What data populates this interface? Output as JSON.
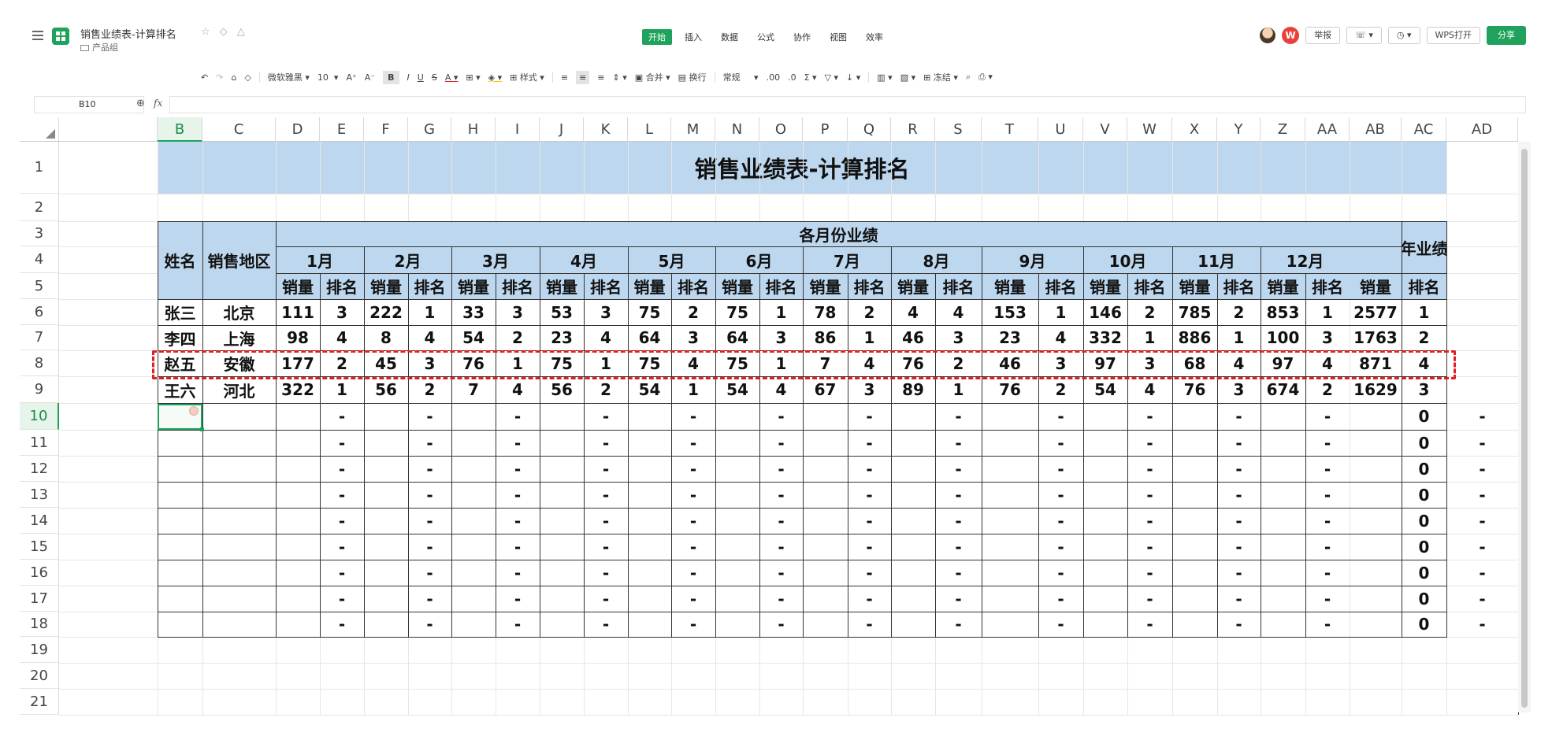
{
  "header": {
    "doc_title": "销售业绩表-计算排名",
    "doc_group": "产品组",
    "menu": [
      "开始",
      "插入",
      "数据",
      "公式",
      "协作",
      "视图",
      "效率"
    ],
    "active_menu": 0,
    "report_label": "举报",
    "wps_open_label": "WPS打开",
    "share_label": "分享",
    "accent_color": "#1fa35c"
  },
  "toolbar": {
    "font_name": "微软雅黑",
    "font_size": "10",
    "style_label": "样式",
    "merge_label": "合并",
    "wrap_label": "换行",
    "number_format": "常规",
    "freeze_label": "冻结"
  },
  "formula_bar": {
    "cell_ref": "B10",
    "fx_label": "fx",
    "content": ""
  },
  "columns": [
    "B",
    "C",
    "D",
    "E",
    "F",
    "G",
    "H",
    "I",
    "J",
    "K",
    "L",
    "M",
    "N",
    "O",
    "P",
    "Q",
    "R",
    "S",
    "T",
    "U",
    "V",
    "W",
    "X",
    "Y",
    "Z",
    "AA",
    "AB",
    "AC",
    "AD"
  ],
  "rows": [
    "1",
    "2",
    "3",
    "4",
    "5",
    "6",
    "7",
    "8",
    "9",
    "10",
    "11",
    "12",
    "13",
    "14",
    "15",
    "16",
    "17",
    "18",
    "19",
    "20",
    "21"
  ],
  "selected_cell": "B10",
  "table": {
    "title": "销售业绩表-计算排名",
    "col_name": "姓名",
    "col_region": "销售地区",
    "group_header": "各月份业绩",
    "months": [
      "1月",
      "2月",
      "3月",
      "4月",
      "5月",
      "6月",
      "7月",
      "8月",
      "9月",
      "10月",
      "11月",
      "12月"
    ],
    "year_header": "年业绩",
    "sub_sales": "销量",
    "sub_rank": "排名",
    "header_fill": "#bdd7ee",
    "highlight_color": "#e02020",
    "highlight_row": "8",
    "records": [
      {
        "name": "张三",
        "region": "北京",
        "values": [
          "111",
          "3",
          "222",
          "1",
          "33",
          "3",
          "53",
          "3",
          "75",
          "2",
          "75",
          "1",
          "78",
          "2",
          "4",
          "4",
          "153",
          "1",
          "146",
          "2",
          "785",
          "2",
          "853",
          "1",
          "2577",
          "1"
        ]
      },
      {
        "name": "李四",
        "region": "上海",
        "values": [
          "98",
          "4",
          "8",
          "4",
          "54",
          "2",
          "23",
          "4",
          "64",
          "3",
          "64",
          "3",
          "86",
          "1",
          "46",
          "3",
          "23",
          "4",
          "332",
          "1",
          "886",
          "1",
          "100",
          "3",
          "1763",
          "2"
        ]
      },
      {
        "name": "赵五",
        "region": "安徽",
        "values": [
          "177",
          "2",
          "45",
          "3",
          "76",
          "1",
          "75",
          "1",
          "75",
          "4",
          "75",
          "1",
          "7",
          "4",
          "76",
          "2",
          "46",
          "3",
          "97",
          "3",
          "68",
          "4",
          "97",
          "4",
          "871",
          "4"
        ]
      },
      {
        "name": "王六",
        "region": "河北",
        "values": [
          "322",
          "1",
          "56",
          "2",
          "7",
          "4",
          "56",
          "2",
          "54",
          "1",
          "54",
          "4",
          "67",
          "3",
          "89",
          "1",
          "76",
          "2",
          "54",
          "4",
          "76",
          "3",
          "674",
          "2",
          "1629",
          "3"
        ]
      }
    ],
    "empty_rank": "-",
    "empty_year_total": "0"
  }
}
